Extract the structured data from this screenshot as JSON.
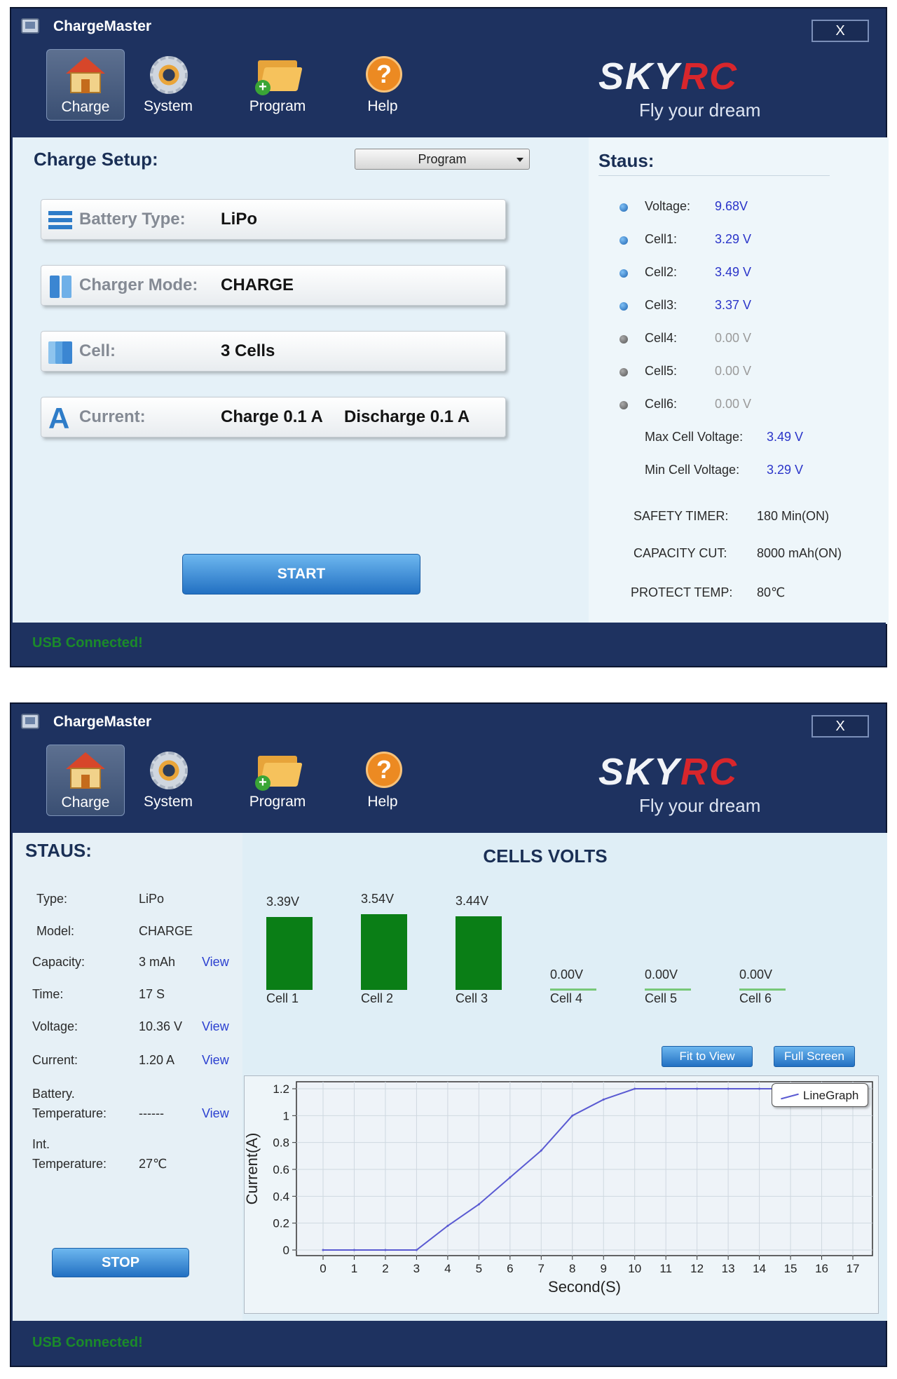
{
  "window1": {
    "app_title": "ChargeMaster",
    "close_label": "X",
    "toolbar": {
      "charge": "Charge",
      "system": "System",
      "program": "Program",
      "help": "Help",
      "help_glyph": "?"
    },
    "brand": {
      "sky": "SKY",
      "rc": "RC",
      "tagline": "Fly your dream"
    },
    "setup": {
      "title": "Charge Setup:",
      "program_select": "Program",
      "battery_type_label": "Battery Type:",
      "battery_type_value": "LiPo",
      "charger_mode_label": "Charger Mode:",
      "charger_mode_value": "CHARGE",
      "cell_label": "Cell:",
      "cell_value": "3 Cells",
      "current_label": "Current:",
      "current_charge": "Charge 0.1 A",
      "current_discharge": "Discharge 0.1 A",
      "current_icon_glyph": "A",
      "start_label": "START"
    },
    "status": {
      "title": "Staus:",
      "voltage_label": "Voltage:",
      "voltage_value": "9.68V",
      "cell1_label": "Cell1:",
      "cell1_value": "3.29 V",
      "cell2_label": "Cell2:",
      "cell2_value": "3.49 V",
      "cell3_label": "Cell3:",
      "cell3_value": "3.37 V",
      "cell4_label": "Cell4:",
      "cell4_value": "0.00 V",
      "cell5_label": "Cell5:",
      "cell5_value": "0.00 V",
      "cell6_label": "Cell6:",
      "cell6_value": "0.00 V",
      "max_label": "Max Cell Voltage:",
      "max_value": "3.49 V",
      "min_label": "Min Cell Voltage:",
      "min_value": "3.29 V",
      "safety_label": "SAFETY TIMER:",
      "safety_value": "180 Min(ON)",
      "capacity_label": "CAPACITY CUT:",
      "capacity_value": "8000 mAh(ON)",
      "protect_label": "PROTECT TEMP:",
      "protect_value": "80℃"
    },
    "usb_status": "USB Connected!"
  },
  "window2": {
    "app_title": "ChargeMaster",
    "close_label": "X",
    "toolbar": {
      "charge": "Charge",
      "system": "System",
      "program": "Program",
      "help": "Help",
      "help_glyph": "?"
    },
    "brand": {
      "sky": "SKY",
      "rc": "RC",
      "tagline": "Fly your dream"
    },
    "status": {
      "title": "STAUS:",
      "type_label": "Type:",
      "type_value": "LiPo",
      "model_label": "Model:",
      "model_value": "CHARGE",
      "capacity_label": "Capacity:",
      "capacity_value": "3 mAh",
      "time_label": "Time:",
      "time_value": "17 S",
      "voltage_label": "Voltage:",
      "voltage_value": "10.36 V",
      "current_label": "Current:",
      "current_value": "1.20 A",
      "batt_temp_label1": "Battery.",
      "batt_temp_label2": "Temperature:",
      "batt_temp_value": "------",
      "int_temp_label1": "Int.",
      "int_temp_label2": "Temperature:",
      "int_temp_value": "27℃",
      "view_label": "View",
      "stop_label": "STOP"
    },
    "cells_title": "CELLS VOLTS",
    "cells": [
      {
        "name": "Cell 1",
        "voltage": "3.39V",
        "value": 3.39
      },
      {
        "name": "Cell 2",
        "voltage": "3.54V",
        "value": 3.54
      },
      {
        "name": "Cell 3",
        "voltage": "3.44V",
        "value": 3.44
      },
      {
        "name": "Cell 4",
        "voltage": "0.00V",
        "value": 0.0
      },
      {
        "name": "Cell 5",
        "voltage": "0.00V",
        "value": 0.0
      },
      {
        "name": "Cell 6",
        "voltage": "0.00V",
        "value": 0.0
      }
    ],
    "fit_to_view": "Fit to View",
    "full_screen": "Full Screen",
    "usb_status": "USB Connected!"
  },
  "chart_data": {
    "type": "line",
    "xlabel": "Second(S)",
    "ylabel": "Current(A)",
    "xlim": [
      0,
      17
    ],
    "ylim": [
      0,
      1.2
    ],
    "x_ticks": [
      0,
      1,
      2,
      3,
      4,
      5,
      6,
      7,
      8,
      9,
      10,
      11,
      12,
      13,
      14,
      15,
      16,
      17
    ],
    "y_ticks": [
      0,
      0.2,
      0.4,
      0.6,
      0.8,
      1,
      1.2
    ],
    "grid": true,
    "legend_position": "top-right",
    "line_color": "#5a5ad2",
    "series": [
      {
        "name": "LineGraph",
        "x": [
          0,
          1,
          2,
          3,
          4,
          5,
          6,
          7,
          8,
          9,
          10,
          11,
          12,
          13,
          14,
          15,
          16,
          17
        ],
        "y": [
          0,
          0,
          0,
          0,
          0.18,
          0.34,
          0.54,
          0.74,
          1.0,
          1.12,
          1.2,
          1.2,
          1.2,
          1.2,
          1.2,
          1.2,
          1.2,
          1.2
        ]
      }
    ]
  }
}
